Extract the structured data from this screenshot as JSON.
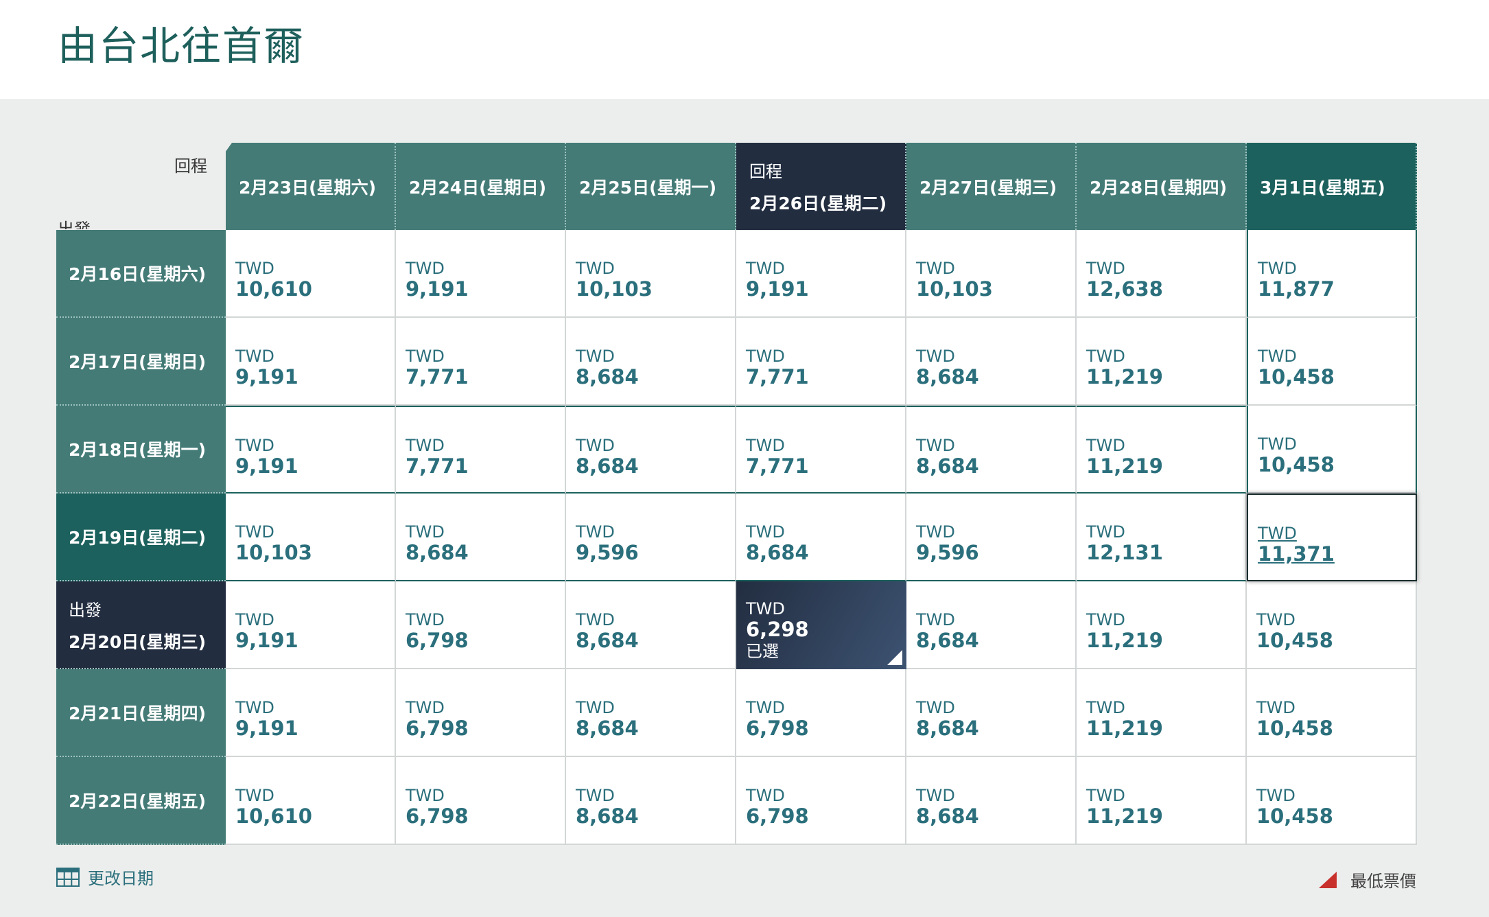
{
  "title": "由台北往首爾",
  "grid": {
    "return_label": "回程",
    "depart_label": "出發",
    "currency": "TWD",
    "selected_label": "已選",
    "return_dates": [
      "2月23日(星期六)",
      "2月24日(星期日)",
      "2月25日(星期一)",
      "2月26日(星期二)",
      "2月27日(星期三)",
      "2月28日(星期四)",
      "3月1日(星期五)"
    ],
    "depart_dates": [
      "2月16日(星期六)",
      "2月17日(星期日)",
      "2月18日(星期一)",
      "2月19日(星期二)",
      "2月20日(星期三)",
      "2月21日(星期四)",
      "2月22日(星期五)"
    ],
    "prices": [
      [
        "10,610",
        "9,191",
        "10,103",
        "9,191",
        "10,103",
        "12,638",
        "11,877"
      ],
      [
        "9,191",
        "7,771",
        "8,684",
        "7,771",
        "8,684",
        "11,219",
        "10,458"
      ],
      [
        "9,191",
        "7,771",
        "8,684",
        "7,771",
        "8,684",
        "11,219",
        "10,458"
      ],
      [
        "10,103",
        "8,684",
        "9,596",
        "8,684",
        "9,596",
        "12,131",
        "11,371"
      ],
      [
        "9,191",
        "6,798",
        "8,684",
        "6,298",
        "8,684",
        "11,219",
        "10,458"
      ],
      [
        "9,191",
        "6,798",
        "8,684",
        "6,798",
        "8,684",
        "11,219",
        "10,458"
      ],
      [
        "10,610",
        "6,798",
        "8,684",
        "6,798",
        "8,684",
        "11,219",
        "10,458"
      ]
    ],
    "selected": {
      "row": 4,
      "col": 3
    },
    "highlight": {
      "row": 3,
      "col": 6
    }
  },
  "footer": {
    "change_date_label": "更改日期",
    "lowest_fare_label": "最低票價"
  },
  "colors": {
    "header_teal": "#447b77",
    "dark_teal": "#1c615d",
    "navy": "#222d40",
    "price_text": "#2b6f7c",
    "lowest_marker": "#c8302b"
  },
  "icons": {
    "change_date": "calendar-icon",
    "lowest_fare": "red-triangle-icon",
    "selected_corner": "white-triangle-icon"
  }
}
